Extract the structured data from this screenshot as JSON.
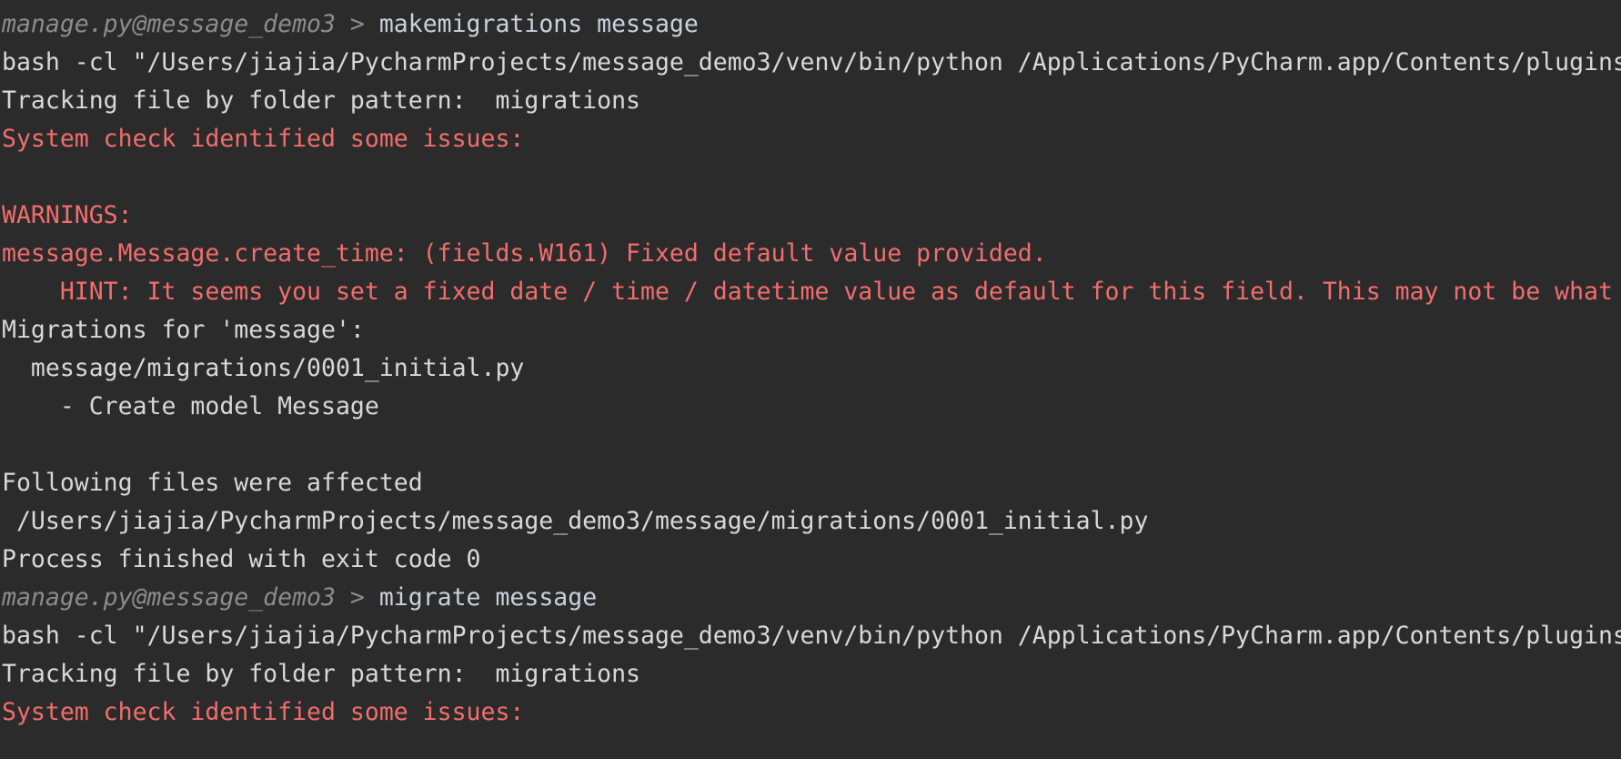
{
  "console": {
    "lines": [
      {
        "kind": "prompt",
        "prefix": "manage.py@message_demo3 > ",
        "command": "makemigrations message"
      },
      {
        "kind": "plain",
        "text": "bash -cl \"/Users/jiajia/PycharmProjects/message_demo3/venv/bin/python /Applications/PyCharm.app/Contents/plugins"
      },
      {
        "kind": "plain",
        "text": "Tracking file by folder pattern:  migrations"
      },
      {
        "kind": "red",
        "text": "System check identified some issues:"
      },
      {
        "kind": "blank",
        "text": ""
      },
      {
        "kind": "red",
        "text": "WARNINGS:"
      },
      {
        "kind": "red",
        "text": "message.Message.create_time: (fields.W161) Fixed default value provided."
      },
      {
        "kind": "red",
        "text": "    HINT: It seems you set a fixed date / time / datetime value as default for this field. This may not be what"
      },
      {
        "kind": "plain",
        "text": "Migrations for 'message':"
      },
      {
        "kind": "plain",
        "text": "  message/migrations/0001_initial.py"
      },
      {
        "kind": "plain",
        "text": "    - Create model Message"
      },
      {
        "kind": "blank",
        "text": ""
      },
      {
        "kind": "plain",
        "text": "Following files were affected"
      },
      {
        "kind": "plain",
        "text": " /Users/jiajia/PycharmProjects/message_demo3/message/migrations/0001_initial.py"
      },
      {
        "kind": "plain",
        "text": "Process finished with exit code 0"
      },
      {
        "kind": "prompt",
        "prefix": "manage.py@message_demo3 > ",
        "command": "migrate message"
      },
      {
        "kind": "plain",
        "text": "bash -cl \"/Users/jiajia/PycharmProjects/message_demo3/venv/bin/python /Applications/PyCharm.app/Contents/plugins"
      },
      {
        "kind": "plain",
        "text": "Tracking file by folder pattern:  migrations"
      },
      {
        "kind": "red",
        "text": "System check identified some issues:"
      }
    ]
  },
  "colors": {
    "background": "#2b2b2b",
    "text": "#d8d8d8",
    "error": "#f26d6d",
    "prompt_prefix": "#8c8c8c",
    "prompt_command": "#c8d1dd"
  }
}
